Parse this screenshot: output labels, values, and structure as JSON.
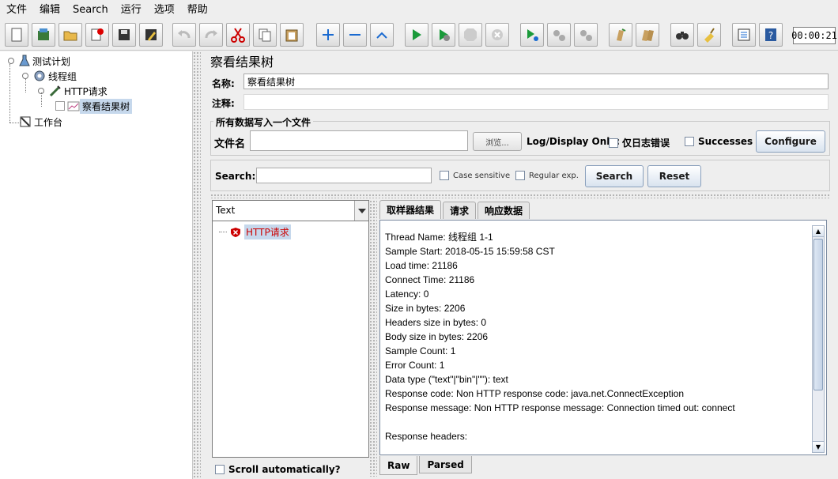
{
  "menu": [
    "文件",
    "编辑",
    "Search",
    "运行",
    "选项",
    "帮助"
  ],
  "toolbar": {
    "timer": "00:00:21",
    "buttons": [
      "new-icon",
      "templates-icon",
      "open-icon",
      "close-icon",
      "save-icon",
      "save-as-icon",
      "undo-icon",
      "redo-icon",
      "cut-icon",
      "copy-icon",
      "paste-icon",
      "expand-icon",
      "collapse-icon",
      "toggle-icon",
      "start-icon",
      "start-no-pause-icon",
      "stop-icon",
      "shutdown-icon",
      "remote-start-icon",
      "remote-stop-icon",
      "remote-shutdown-icon",
      "clear-icon",
      "clear-all-icon",
      "search-icon",
      "reset-search-icon",
      "function-helper-icon",
      "help-icon"
    ]
  },
  "tree": {
    "nodes": [
      {
        "label": "测试计划",
        "icon": "test-plan-icon"
      },
      {
        "label": "线程组",
        "icon": "thread-group-icon"
      },
      {
        "label": "HTTP请求",
        "icon": "sampler-icon"
      },
      {
        "label": "察看结果树",
        "icon": "listener-icon"
      },
      {
        "label": "工作台",
        "icon": "workbench-icon"
      }
    ]
  },
  "panel": {
    "title": "察看结果树",
    "name_label": "名称:",
    "name_value": "察看结果树",
    "comment_label": "注释:",
    "comment_value": "",
    "file_group_title": "所有数据写入一个文件",
    "file_label": "文件名",
    "file_value": "",
    "browse_label": "浏览...",
    "log_display_label": "Log/Display Only:",
    "errors_only_label": "仅日志错误",
    "successes_label": "Successes",
    "configure_label": "Configure",
    "search_label": "Search:",
    "search_value": "",
    "case_sensitive_label": "Case sensitive",
    "regex_label": "Regular exp.",
    "search_button": "Search",
    "reset_button": "Reset"
  },
  "results": {
    "renderer": "Text",
    "items": [
      {
        "label": "HTTP请求",
        "status": "error"
      }
    ],
    "scroll_auto_label": "Scroll automatically?"
  },
  "tabs": [
    "取样器结果",
    "请求",
    "响应数据"
  ],
  "bottom_tabs": [
    "Raw",
    "Parsed"
  ],
  "detail": {
    "lines": [
      "Thread Name: 线程组 1-1",
      "Sample Start: 2018-05-15 15:59:58 CST",
      "Load time: 21186",
      "Connect Time: 21186",
      "Latency: 0",
      "Size in bytes: 2206",
      "Headers size in bytes: 0",
      "Body size in bytes: 2206",
      "Sample Count: 1",
      "Error Count: 1",
      "Data type (\"text\"|\"bin\"|\"\"): text",
      "Response code: Non HTTP response code: java.net.ConnectException",
      "Response message: Non HTTP response message: Connection timed out: connect",
      "",
      "Response headers:"
    ]
  }
}
